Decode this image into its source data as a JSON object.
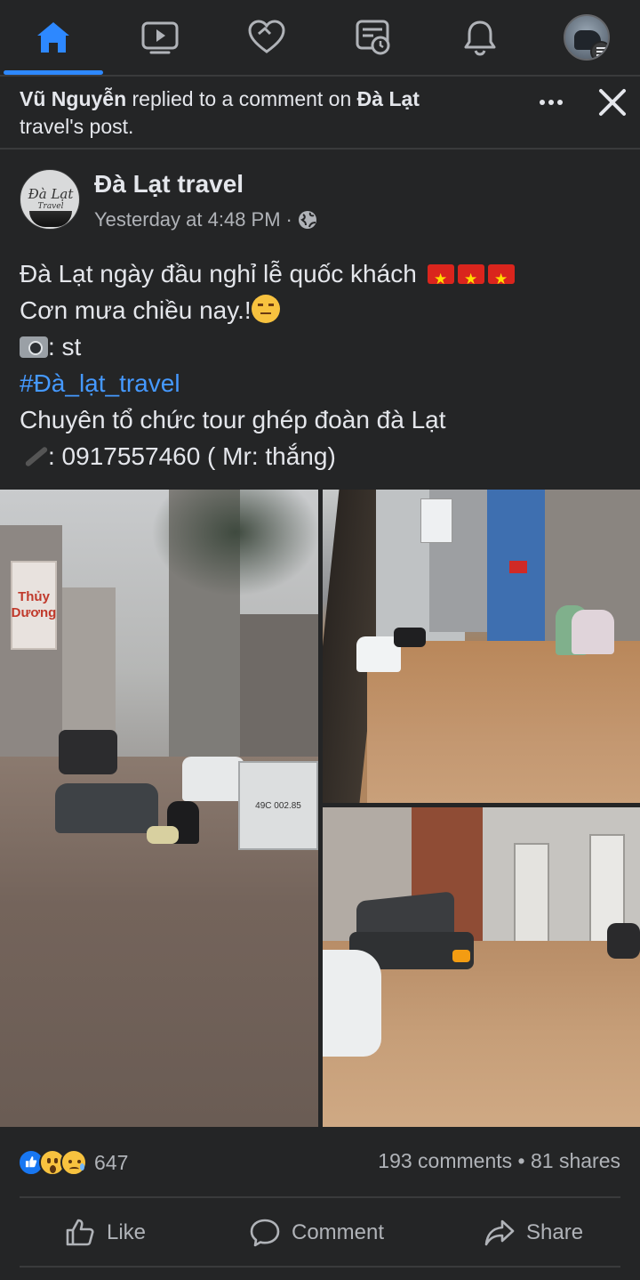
{
  "nav": {
    "items": [
      {
        "name": "home",
        "active": true
      },
      {
        "name": "watch"
      },
      {
        "name": "dating"
      },
      {
        "name": "news"
      },
      {
        "name": "notifications"
      },
      {
        "name": "menu"
      }
    ],
    "active_color": "#2d88ff"
  },
  "notification": {
    "actor": "Vũ Nguyễn",
    "action": " replied to a comment on ",
    "target": "Đà Lạt",
    "target_rest": " travel's post."
  },
  "post": {
    "page_name": "Đà Lạt travel",
    "avatar_text": "Đà Lạt",
    "avatar_subtext": "Travel",
    "timestamp": "Yesterday at 4:48 PM",
    "separator": "·",
    "privacy_icon": "globe-icon",
    "lines": {
      "line1": "Đà Lạt ngày đầu nghỉ lễ quốc khách ",
      "line2": "Cơn mưa chiều nay.!",
      "line3": ": st",
      "hashtag": "#Đà_lạt_travel",
      "line5": "Chuyên tổ chức tour ghép đoàn đà Lạt",
      "line6": ": 0917557460 ( Mr: thắng)"
    },
    "photo_text": {
      "shop_sign": "Thủy Dương",
      "plate": "49C 002.85"
    }
  },
  "engagement": {
    "reaction_count": "647",
    "comments": "193 comments",
    "dot": " • ",
    "shares": "81 shares"
  },
  "actions": {
    "like": "Like",
    "comment": "Comment",
    "share": "Share"
  }
}
